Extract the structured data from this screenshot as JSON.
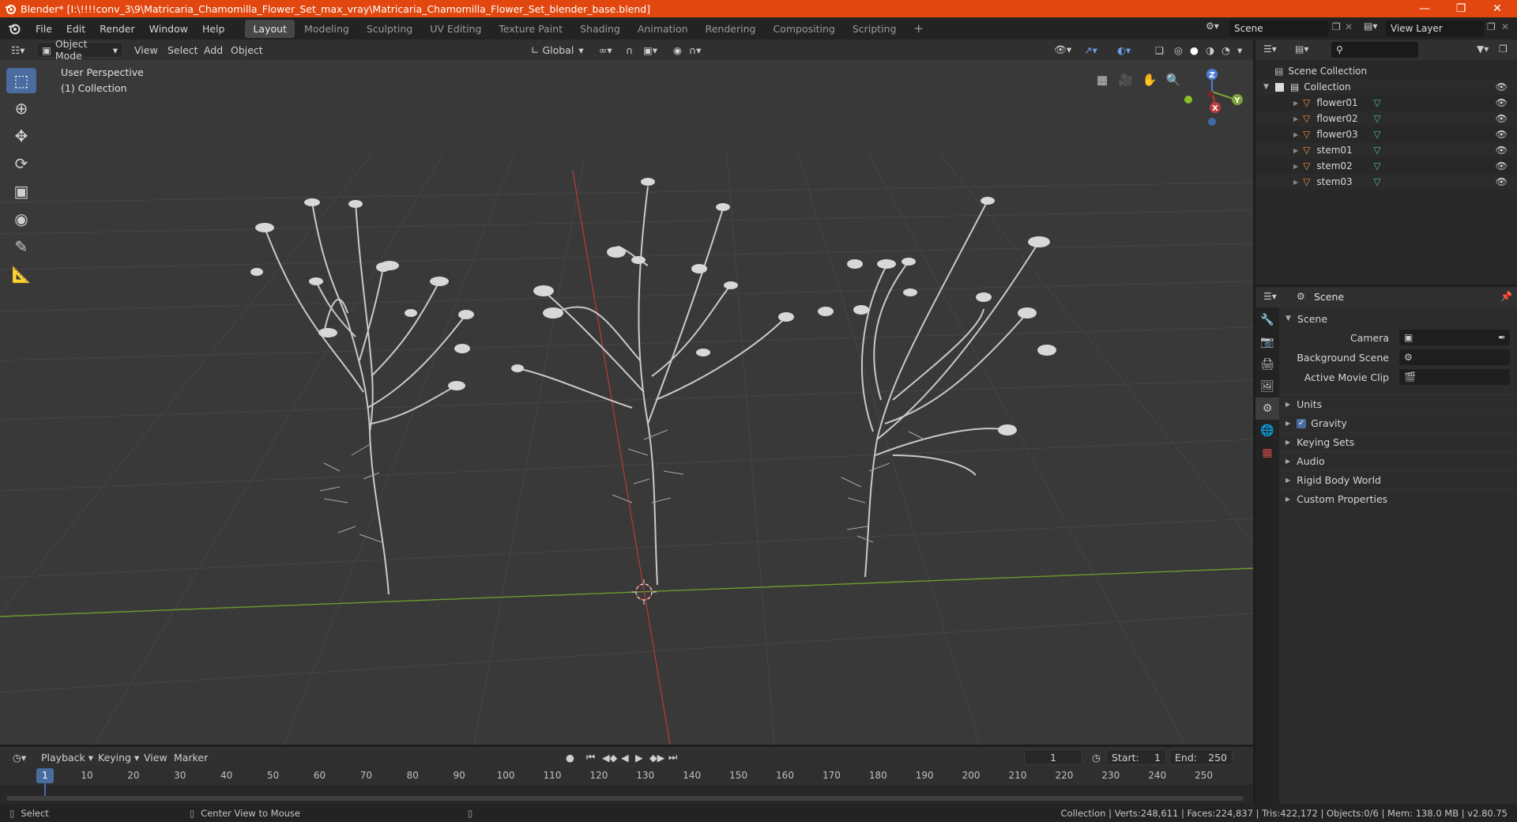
{
  "titlebar": {
    "title": "Blender* [I:\\!!!!conv_3\\9\\Matricaria_Chamomilla_Flower_Set_max_vray\\Matricaria_Chamomilla_Flower_Set_blender_base.blend]",
    "accent": "#e1470e"
  },
  "menus": [
    "File",
    "Edit",
    "Render",
    "Window",
    "Help"
  ],
  "workspaces": [
    "Layout",
    "Modeling",
    "Sculpting",
    "UV Editing",
    "Texture Paint",
    "Shading",
    "Animation",
    "Rendering",
    "Compositing",
    "Scripting"
  ],
  "workspace_active": "Layout",
  "scene_field": "Scene",
  "view_layer_field": "View Layer",
  "viewport_header": {
    "mode": "Object Mode",
    "menus": [
      "View",
      "Select",
      "Add",
      "Object"
    ],
    "transform_orientation": "Global"
  },
  "viewport": {
    "perspective_label": "User Perspective",
    "collection_label": "(1) Collection",
    "gizmo_axes": [
      "X",
      "Y",
      "Z"
    ]
  },
  "outliner": {
    "root": "Scene Collection",
    "collection": "Collection",
    "objects": [
      "flower01",
      "flower02",
      "flower03",
      "stem01",
      "stem02",
      "stem03"
    ]
  },
  "properties": {
    "header_title": "Scene",
    "panel_title": "Scene",
    "fields": [
      {
        "label": "Camera",
        "value": ""
      },
      {
        "label": "Background Scene",
        "value": ""
      },
      {
        "label": "Active Movie Clip",
        "value": ""
      }
    ],
    "sections": [
      "Units",
      "Gravity",
      "Keying Sets",
      "Audio",
      "Rigid Body World",
      "Custom Properties"
    ],
    "gravity_checked": true
  },
  "timeline": {
    "menus": [
      "Playback",
      "Keying",
      "View",
      "Marker"
    ],
    "current_frame": "1",
    "start_label": "Start:",
    "start_value": "1",
    "end_label": "End:",
    "end_value": "250",
    "ticks": [
      "1",
      "10",
      "20",
      "30",
      "40",
      "50",
      "60",
      "70",
      "80",
      "90",
      "100",
      "110",
      "120",
      "130",
      "140",
      "150",
      "160",
      "170",
      "180",
      "190",
      "200",
      "210",
      "220",
      "230",
      "240",
      "250"
    ]
  },
  "statusbar": {
    "left_action": "Select",
    "middle_action": "Center View to Mouse",
    "stats": "Collection | Verts:248,611 | Faces:224,837 | Tris:422,172 | Objects:0/6 | Mem: 138.0 MB | v2.80.75"
  }
}
